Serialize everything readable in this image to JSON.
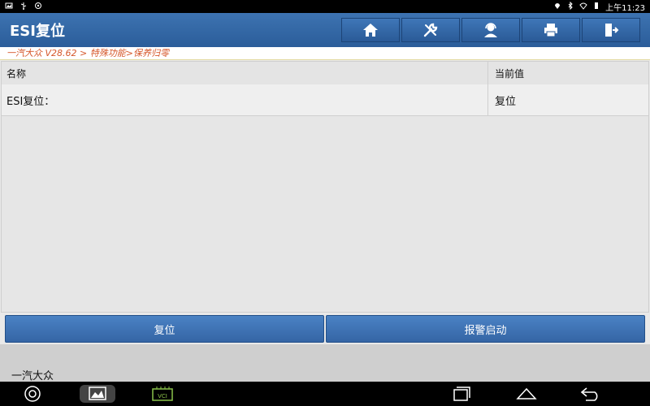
{
  "status_bar": {
    "time": "上午11:23",
    "left_icons": [
      "image-icon",
      "usb-icon",
      "settings-icon"
    ],
    "right_icons": [
      "location-icon",
      "bluetooth-icon",
      "wifi-icon",
      "battery-icon"
    ]
  },
  "header": {
    "title": "ESI复位",
    "toolbar": [
      {
        "name": "home-button",
        "icon": "home-icon"
      },
      {
        "name": "diagnose-button",
        "icon": "wrench-icon"
      },
      {
        "name": "support-button",
        "icon": "user-support-icon"
      },
      {
        "name": "print-button",
        "icon": "printer-icon"
      },
      {
        "name": "exit-button",
        "icon": "exit-icon"
      }
    ]
  },
  "breadcrumb": "一汽大众 V28.62 > 特殊功能>保养归零",
  "table": {
    "headers": [
      "名称",
      "当前值"
    ],
    "rows": [
      {
        "name": "ESI复位：",
        "value": "复位"
      }
    ]
  },
  "actions": {
    "reset_label": "复位",
    "alarm_label": "报警启动"
  },
  "footer": {
    "vehicle": "一汽大众"
  },
  "nav_bar": {
    "items": [
      "browser-icon",
      "gallery-icon",
      "vci-icon",
      "recent-apps-icon",
      "home-nav-icon",
      "back-icon"
    ],
    "vci_label": "VCI"
  },
  "colors": {
    "header_blue": "#2f63a3",
    "breadcrumb_text": "#d5572b",
    "button_blue": "#3f76b8"
  }
}
